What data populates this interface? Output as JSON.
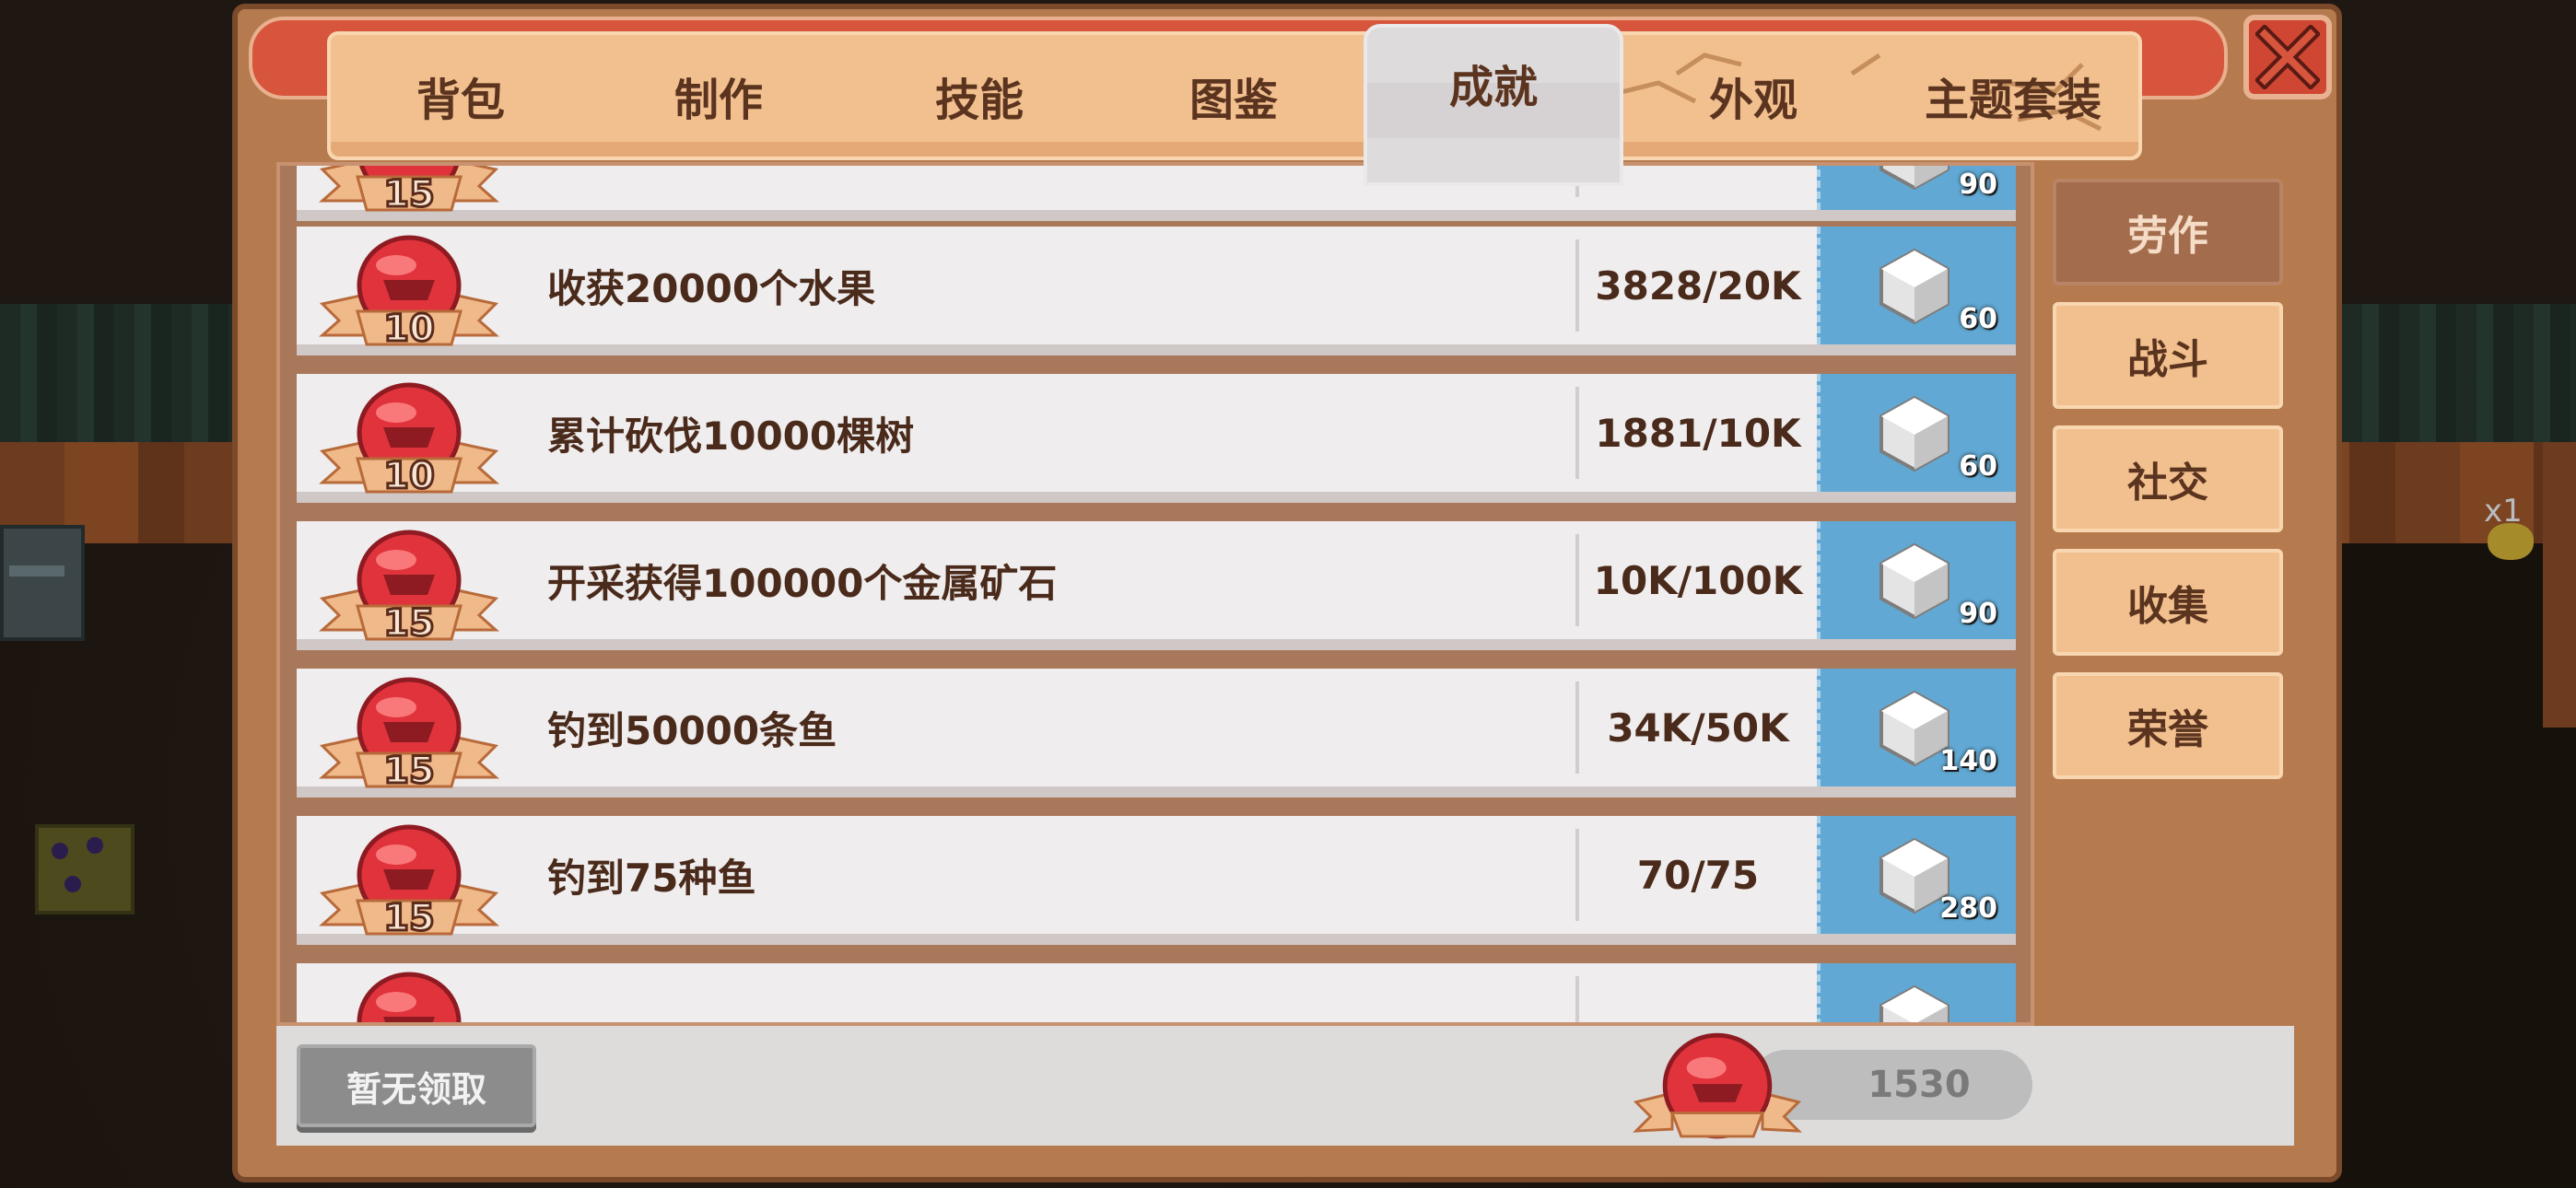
{
  "tabs": [
    {
      "label": "背包"
    },
    {
      "label": "制作"
    },
    {
      "label": "技能"
    },
    {
      "label": "图鉴"
    },
    {
      "label": "成就",
      "active": true
    },
    {
      "label": "外观"
    },
    {
      "label": "主题套装"
    }
  ],
  "categories": [
    {
      "label": "劳作",
      "active": true
    },
    {
      "label": "战斗"
    },
    {
      "label": "社交"
    },
    {
      "label": "收集"
    },
    {
      "label": "荣誉"
    }
  ],
  "achievements": [
    {
      "points": "15",
      "desc": "",
      "progress": "",
      "reward": "90"
    },
    {
      "points": "10",
      "desc": "收获20000个水果",
      "progress": "3828/20K",
      "reward": "60"
    },
    {
      "points": "10",
      "desc": "累计砍伐10000棵树",
      "progress": "1881/10K",
      "reward": "60"
    },
    {
      "points": "15",
      "desc": "开采获得100000个金属矿石",
      "progress": "10K/100K",
      "reward": "90"
    },
    {
      "points": "15",
      "desc": "钓到50000条鱼",
      "progress": "34K/50K",
      "reward": "140"
    },
    {
      "points": "15",
      "desc": "钓到75种鱼",
      "progress": "70/75",
      "reward": "280"
    },
    {
      "points": "",
      "desc": "",
      "progress": "",
      "reward": ""
    }
  ],
  "footer": {
    "claim_label": "暂无领取",
    "total_points": "1530"
  },
  "world": {
    "item_count": "x1"
  },
  "colors": {
    "panel": "#b57b4e",
    "tab": "#f2c08e",
    "tab_active": "#dddbdc",
    "reward_bg": "#61a9d4",
    "badge_red": "#e0333c",
    "ribbon": "#f0b98a",
    "close_red": "#cf4733"
  },
  "icons": {
    "close": "close-x-icon",
    "badge": "achievement-medal-icon",
    "reward": "silver-gem-icon"
  }
}
